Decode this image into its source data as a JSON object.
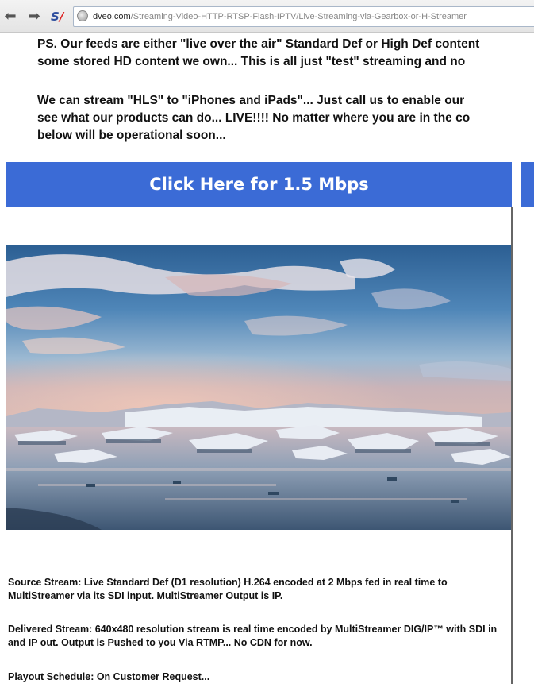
{
  "browser": {
    "back_icon": "back-arrow-icon",
    "forward_icon": "forward-arrow-icon",
    "extension_label_s": "S",
    "extension_label_slash": "/",
    "url_host": "dveo.com",
    "url_path": "/Streaming-Video-HTTP-RTSP-Flash-IPTV/Live-Streaming-via-Gearbox-or-H-Streamer"
  },
  "content": {
    "paragraph1_line1": "PS. Our feeds are either \"live over the air\" Standard Def or High Def content",
    "paragraph1_line2": "some stored HD content we own... This is all just \"test\" streaming and no",
    "paragraph2_line1": "We can stream \"HLS\" to \"iPhones and iPads\"... Just call us to enable our",
    "paragraph2_line2": "see what our products can do... LIVE!!!! No matter where you are in the co",
    "paragraph2_line3": "below will be operational soon...",
    "stream_button_label": "Click Here for 1.5 Mbps",
    "source_stream": "Source Stream: Live Standard Def (D1 resolution) H.264 encoded at 2 Mbps fed in real time to MultiStreamer via its SDI input. MultiStreamer Output is IP.",
    "delivered_stream": "Delivered Stream: 640x480 resolution stream is real time encoded by MultiStreamer DIG/IP™ with SDI in and IP out. Output is Pushed to you Via RTMP... No CDN for now.",
    "playout_schedule": "Playout Schedule: On Customer Request..."
  },
  "colors": {
    "banner": "#3b6bd6",
    "banner_text": "#ffffff"
  }
}
